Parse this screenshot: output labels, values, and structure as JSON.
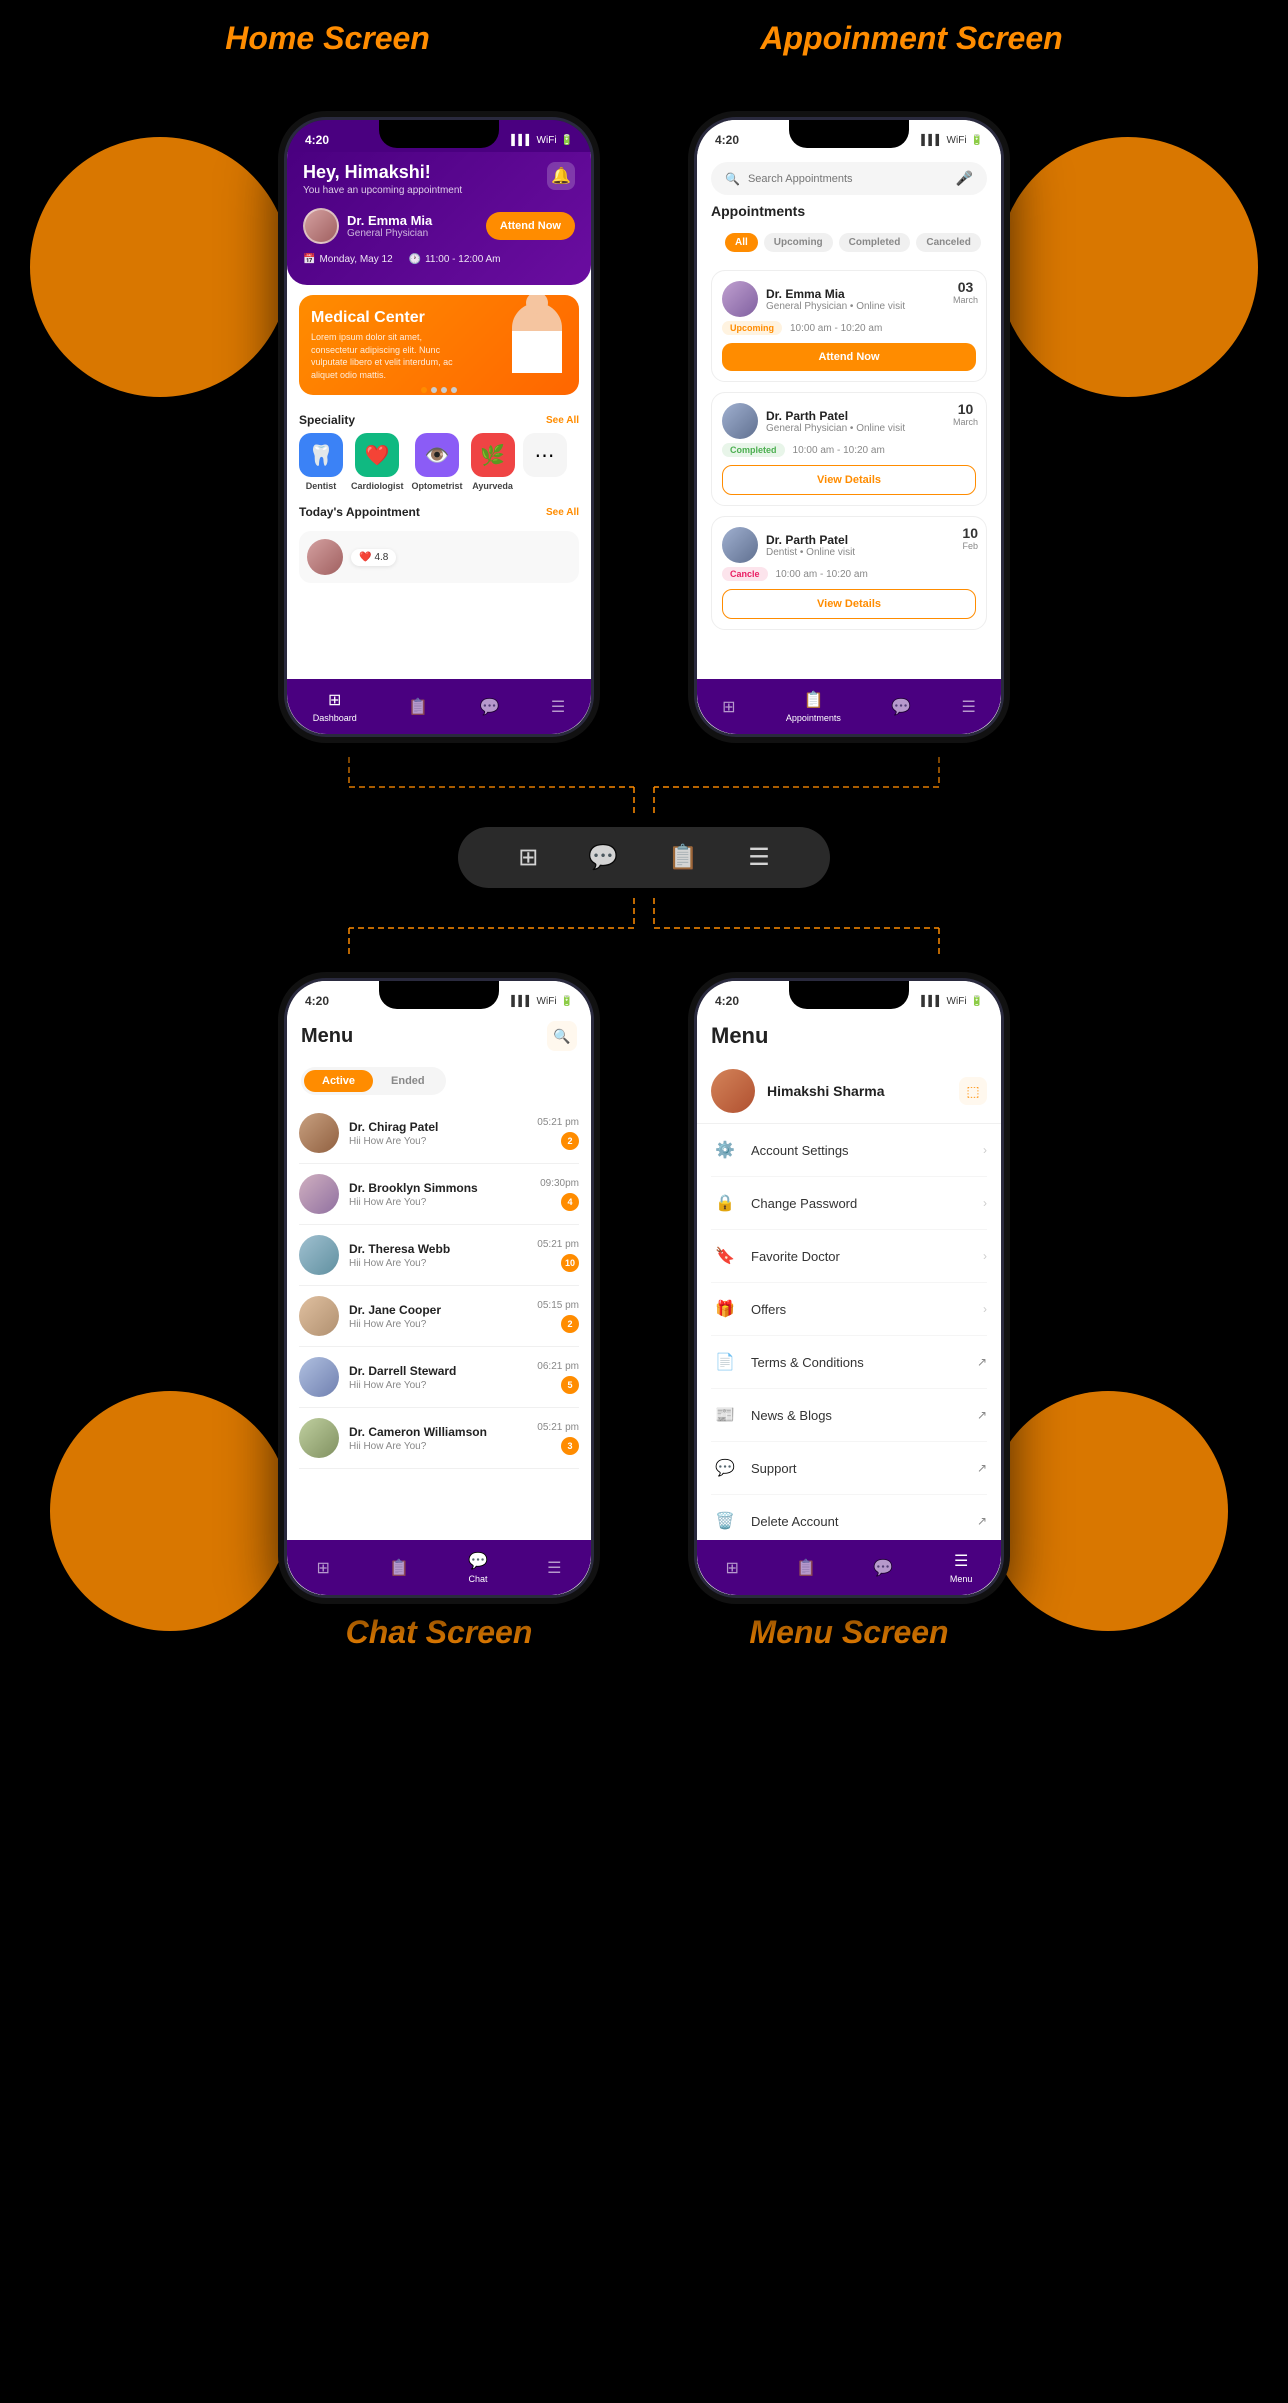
{
  "page": {
    "background": "#000",
    "top_left_title": "Home Screen",
    "top_right_title": "Appoinment Screen",
    "bottom_left_title": "Chat Screen",
    "bottom_right_title": "Menu Screen"
  },
  "home_screen": {
    "status_time": "4:20",
    "greeting": "Hey, Himakshi!",
    "subtext": "You have an upcoming appointment",
    "doctor_name": "Dr. Emma Mia",
    "doctor_specialty": "General Physician",
    "attend_btn": "Attend Now",
    "date": "Monday, May 12",
    "time": "11:00 - 12:00 Am",
    "banner_title": "Medical Center",
    "banner_text": "Lorem ipsum dolor sit amet, consectetur adipiscing elit. Nunc vulputate libero et velit interdum, ac aliquet odio mattis.",
    "section_specialty": "Speciality",
    "see_all": "See All",
    "specialties": [
      {
        "name": "Dentist",
        "color": "#3b82f6",
        "icon": "🦷"
      },
      {
        "name": "Cardiologist",
        "color": "#10b981",
        "icon": "❤️"
      },
      {
        "name": "Optometrist",
        "color": "#8b5cf6",
        "icon": "👁️"
      },
      {
        "name": "Ayurveda",
        "color": "#ef4444",
        "icon": "🌿"
      }
    ],
    "today_appointment": "Today's Appointment",
    "rating": "4.8",
    "nav_items": [
      "Dashboard",
      "",
      "",
      ""
    ]
  },
  "appointment_screen": {
    "status_time": "4:20",
    "search_placeholder": "Search Appointments",
    "section_title": "Appointments",
    "tabs": [
      "All",
      "Upcoming",
      "Completed",
      "Canceled"
    ],
    "appointments": [
      {
        "doctor": "Dr. Emma Mia",
        "specialty": "General Physician • Online visit",
        "status": "Upcoming",
        "status_type": "upcoming",
        "time": "10:00 am - 10:20 am",
        "date_num": "03",
        "date_month": "March",
        "action": "Attend Now",
        "action_type": "attend"
      },
      {
        "doctor": "Dr. Parth Patel",
        "specialty": "General Physician • Online visit",
        "status": "Completed",
        "status_type": "completed",
        "time": "10:00 am - 10:20 am",
        "date_num": "10",
        "date_month": "March",
        "action": "View Details",
        "action_type": "view"
      },
      {
        "doctor": "Dr. Parth Patel",
        "specialty": "Dentist • Online visit",
        "status": "Cancle",
        "status_type": "cancelled",
        "time": "10:00 am - 10:20 am",
        "date_num": "10",
        "date_month": "Feb",
        "action": "View Details",
        "action_type": "view"
      }
    ],
    "nav_active": "Appointments"
  },
  "chat_screen": {
    "status_time": "4:20",
    "title": "Menu",
    "toggle_active": "Active",
    "toggle_inactive": "Ended",
    "chats": [
      {
        "name": "Dr. Chirag Patel",
        "message": "Hii How Are You?",
        "time": "05:21 pm",
        "badge": "2"
      },
      {
        "name": "Dr. Brooklyn Simmons",
        "message": "Hii How Are You?",
        "time": "09:30pm",
        "badge": "4"
      },
      {
        "name": "Dr. Theresa Webb",
        "message": "Hii How Are You?",
        "time": "05:21 pm",
        "badge": "10"
      },
      {
        "name": "Dr. Jane Cooper",
        "message": "Hii How Are You?",
        "time": "05:15 pm",
        "badge": "2"
      },
      {
        "name": "Dr. Darrell Steward",
        "message": "Hii How Are You?",
        "time": "06:21 pm",
        "badge": "5"
      },
      {
        "name": "Dr. Cameron Williamson",
        "message": "Hii How Are You?",
        "time": "05:21 pm",
        "badge": "3"
      }
    ],
    "nav_label": "Chat"
  },
  "menu_screen": {
    "status_time": "4:20",
    "title": "Menu",
    "profile_name": "Himakshi Sharma",
    "menu_items": [
      {
        "label": "Account Settings",
        "icon": "⚙️",
        "arrow": "→"
      },
      {
        "label": "Change Password",
        "icon": "🔒",
        "arrow": "→"
      },
      {
        "label": "Favorite Doctor",
        "icon": "🔖",
        "arrow": "→"
      },
      {
        "label": "Offers",
        "icon": "🎁",
        "arrow": "→"
      },
      {
        "label": "Terms & Conditions",
        "icon": "📄",
        "arrow": "↗"
      },
      {
        "label": "News & Blogs",
        "icon": "📰",
        "arrow": "↗"
      },
      {
        "label": "Support",
        "icon": "💬",
        "arrow": "↗"
      },
      {
        "label": "Delete Account",
        "icon": "🗑️",
        "arrow": "↗"
      }
    ],
    "nav_active": "Menu"
  },
  "middle_nav": {
    "icons": [
      "⊞",
      "💬",
      "📋",
      "☰"
    ]
  }
}
